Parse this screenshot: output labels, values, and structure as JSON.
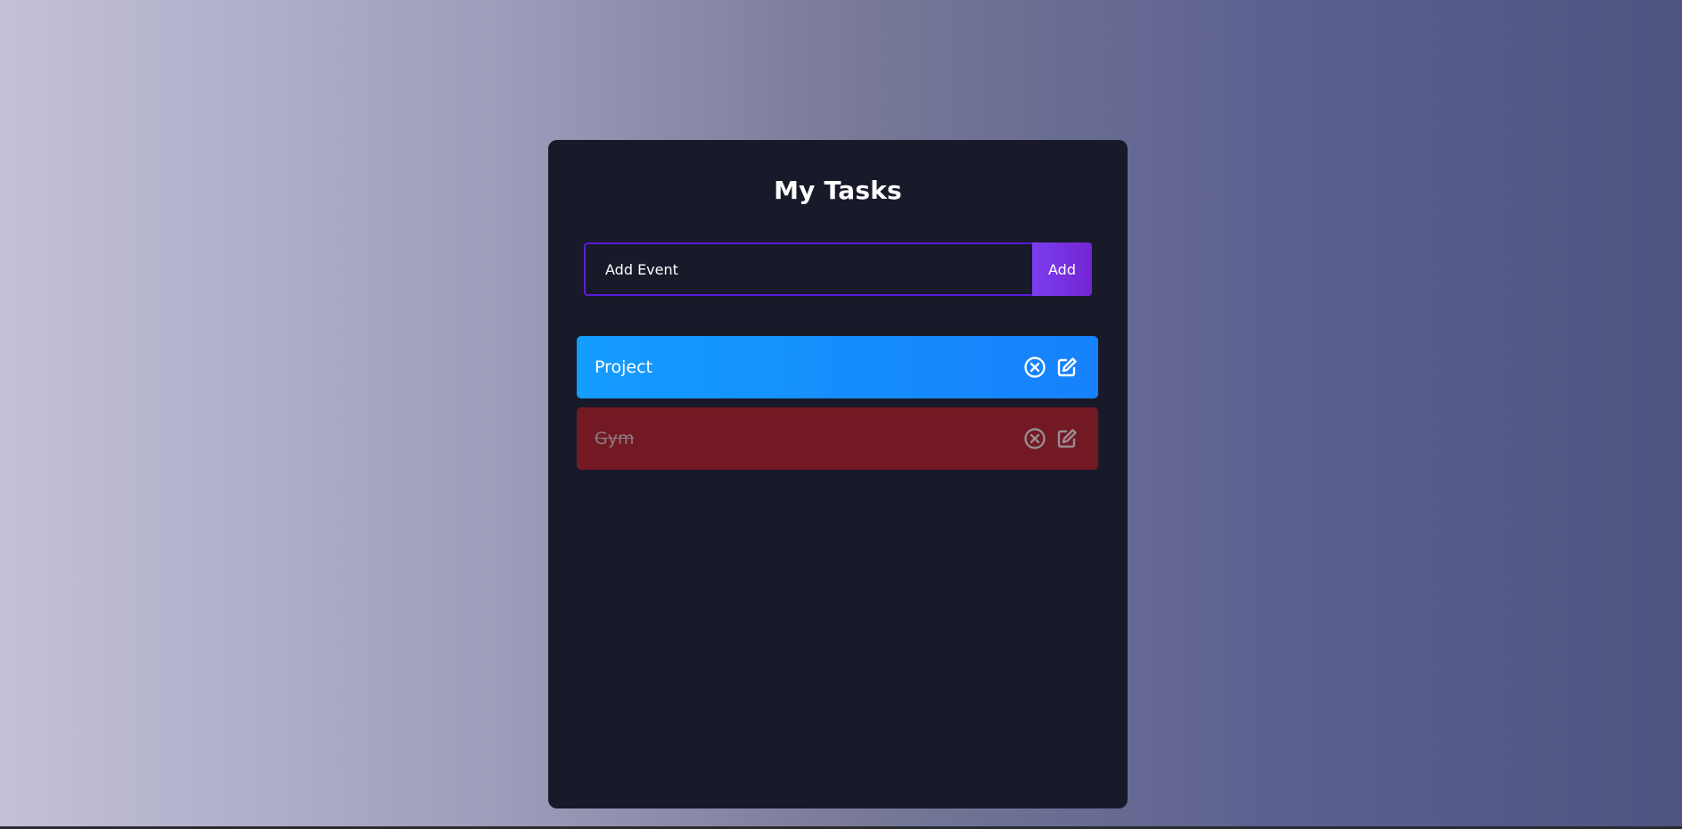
{
  "app": {
    "title": "My Tasks"
  },
  "add_form": {
    "input_placeholder": "Add Event",
    "button_label": "Add"
  },
  "tasks": [
    {
      "label": "Project",
      "completed": false,
      "color": "#1690ff"
    },
    {
      "label": "Gym",
      "completed": true,
      "color": "#731923"
    }
  ],
  "icons": {
    "delete": "close-circle-icon",
    "edit": "edit-icon"
  },
  "colors": {
    "accent": "#5a1ad9",
    "card_background": "#181a2a"
  }
}
